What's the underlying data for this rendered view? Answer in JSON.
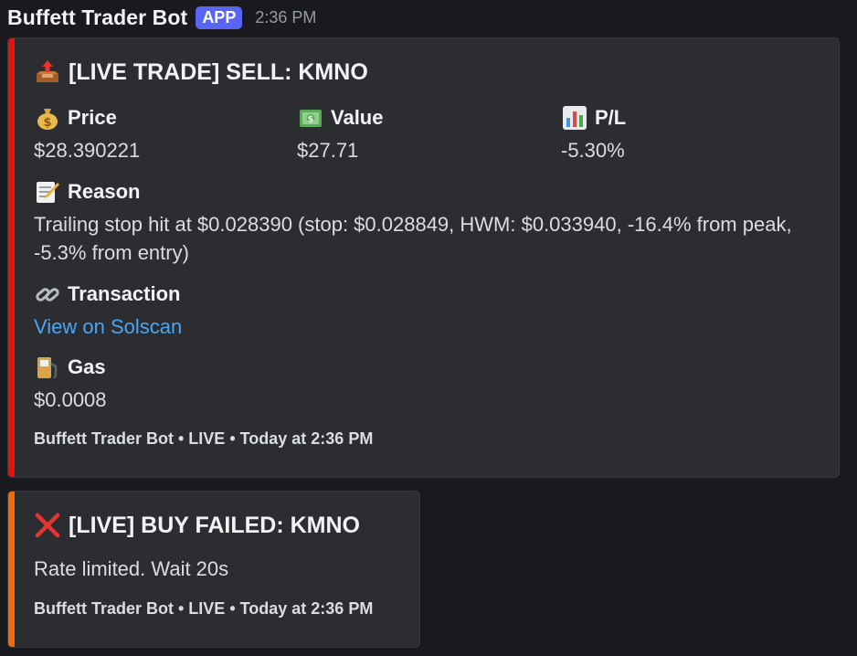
{
  "header": {
    "author": "Buffett Trader Bot",
    "badge": "APP",
    "timestamp": "2:36 PM"
  },
  "embeds": [
    {
      "accent": "#e3120b",
      "title": "[LIVE TRADE] SELL: KMNO",
      "title_icon": "outbox-tray-icon",
      "fields": {
        "price": {
          "icon": "money-bag-icon",
          "name": "Price",
          "value": "$28.390221"
        },
        "value": {
          "icon": "dollar-banknote-icon",
          "name": "Value",
          "value": "$27.71"
        },
        "pl": {
          "icon": "bar-chart-icon",
          "name": "P/L",
          "value": "-5.30%"
        },
        "reason": {
          "icon": "memo-icon",
          "name": "Reason",
          "value": "Trailing stop hit at $0.028390 (stop: $0.028849, HWM: $0.033940, -16.4% from peak, -5.3% from entry)"
        },
        "transaction": {
          "icon": "link-icon",
          "name": "Transaction",
          "value": "View on Solscan"
        },
        "gas": {
          "icon": "fuel-pump-icon",
          "name": "Gas",
          "value": "$0.0008"
        }
      },
      "footer": "Buffett Trader Bot • LIVE • Today at 2:36 PM"
    },
    {
      "accent": "#f26a0b",
      "title": "[LIVE] BUY FAILED: KMNO",
      "title_icon": "cross-mark-icon",
      "description": "Rate limited. Wait 20s",
      "footer": "Buffett Trader Bot • LIVE • Today at 2:36 PM"
    }
  ]
}
